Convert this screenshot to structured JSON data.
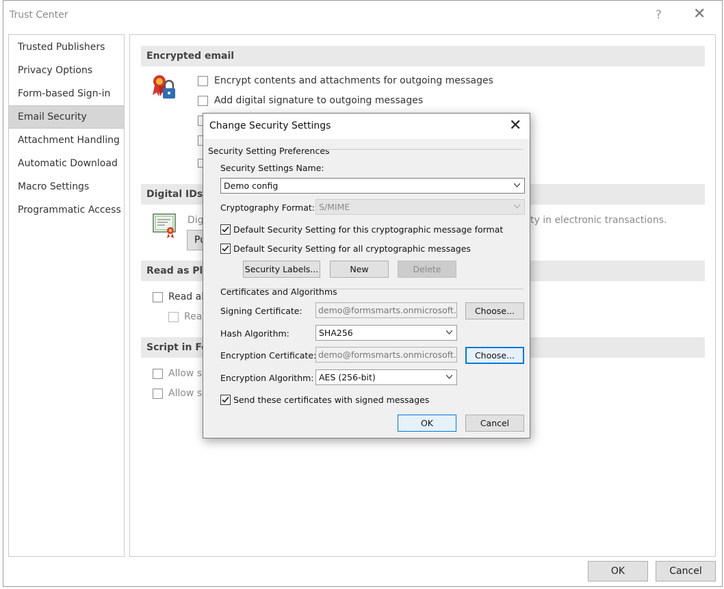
{
  "window": {
    "title": "Trust Center",
    "help": "?",
    "close": "✕"
  },
  "sidebar": {
    "items": [
      {
        "label": "Trusted Publishers",
        "selected": false
      },
      {
        "label": "Privacy Options",
        "selected": false
      },
      {
        "label": "Form-based Sign-in",
        "selected": false
      },
      {
        "label": "Email Security",
        "selected": true
      },
      {
        "label": "Attachment Handling",
        "selected": false
      },
      {
        "label": "Automatic Download",
        "selected": false
      },
      {
        "label": "Macro Settings",
        "selected": false
      },
      {
        "label": "Programmatic Access",
        "selected": false
      }
    ]
  },
  "content": {
    "encrypted": {
      "heading": "Encrypted email",
      "option1": "Encrypt contents and attachments for outgoing messages",
      "option2": "Add digital signature to outgoing messages"
    },
    "digital_ids": {
      "heading": "Digital IDs (",
      "text_left": "Dig",
      "text_right": "ty in electronic transactions.",
      "button_partial": "Pu"
    },
    "read_plain": {
      "heading": "Read as Plai",
      "option1": "Read al",
      "option2": "Rea"
    },
    "script": {
      "heading": "Script in Fol",
      "option1": "Allow sc",
      "option2": "Allow sc"
    }
  },
  "footer": {
    "ok": "OK",
    "cancel": "Cancel"
  },
  "dialog": {
    "title": "Change Security Settings",
    "close": "✕",
    "prefs_group": "Security Setting Preferences",
    "name_label": "Security Settings Name:",
    "name_value": "Demo config",
    "format_label": "Cryptography Format:",
    "format_value": "S/MIME",
    "default_format": {
      "label": "Default Security Setting for this cryptographic message format",
      "checked": true
    },
    "default_all": {
      "label": "Default Security Setting for all cryptographic messages",
      "checked": true
    },
    "security_labels_btn": "Security Labels...",
    "new_btn": "New",
    "delete_btn": "Delete",
    "certs_group": "Certificates and Algorithms",
    "signing_label": "Signing Certificate:",
    "signing_value": "demo@formsmarts.onmicrosoft.com",
    "choose_btn": "Choose...",
    "hash_label": "Hash Algorithm:",
    "hash_value": "SHA256",
    "enc_cert_label": "Encryption Certificate:",
    "enc_cert_value": "demo@formsmarts.onmicrosoft.com",
    "enc_alg_label": "Encryption Algorithm:",
    "enc_alg_value": "AES (256-bit)",
    "send_certs": {
      "label": "Send these certificates with signed messages",
      "checked": true
    },
    "ok_btn": "OK",
    "cancel_btn": "Cancel"
  }
}
